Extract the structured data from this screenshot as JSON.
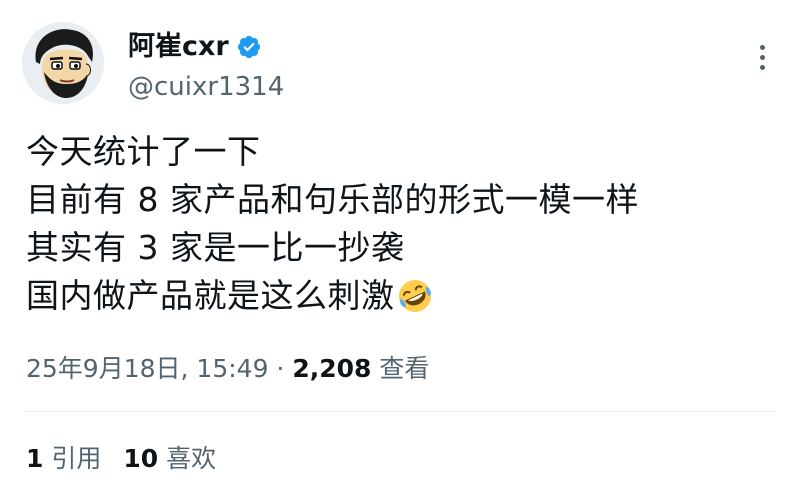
{
  "user": {
    "display_name": "阿崔cxr",
    "handle": "@cuixr1314",
    "verified_color": "#1d9bf0"
  },
  "tweet": {
    "lines": [
      "今天统计了一下",
      "目前有 8 家产品和句乐部的形式一模一样",
      "其实有 3 家是一比一抄袭",
      "国内做产品就是这么刺激"
    ],
    "emoji": "rolling-on-floor-laughing"
  },
  "meta": {
    "timestamp": "25年9月18日, 15:49",
    "separator": " · ",
    "views_count": "2,208",
    "views_label": "查看"
  },
  "stats": {
    "quotes_count": "1",
    "quotes_label": "引用",
    "likes_count": "10",
    "likes_label": "喜欢"
  }
}
